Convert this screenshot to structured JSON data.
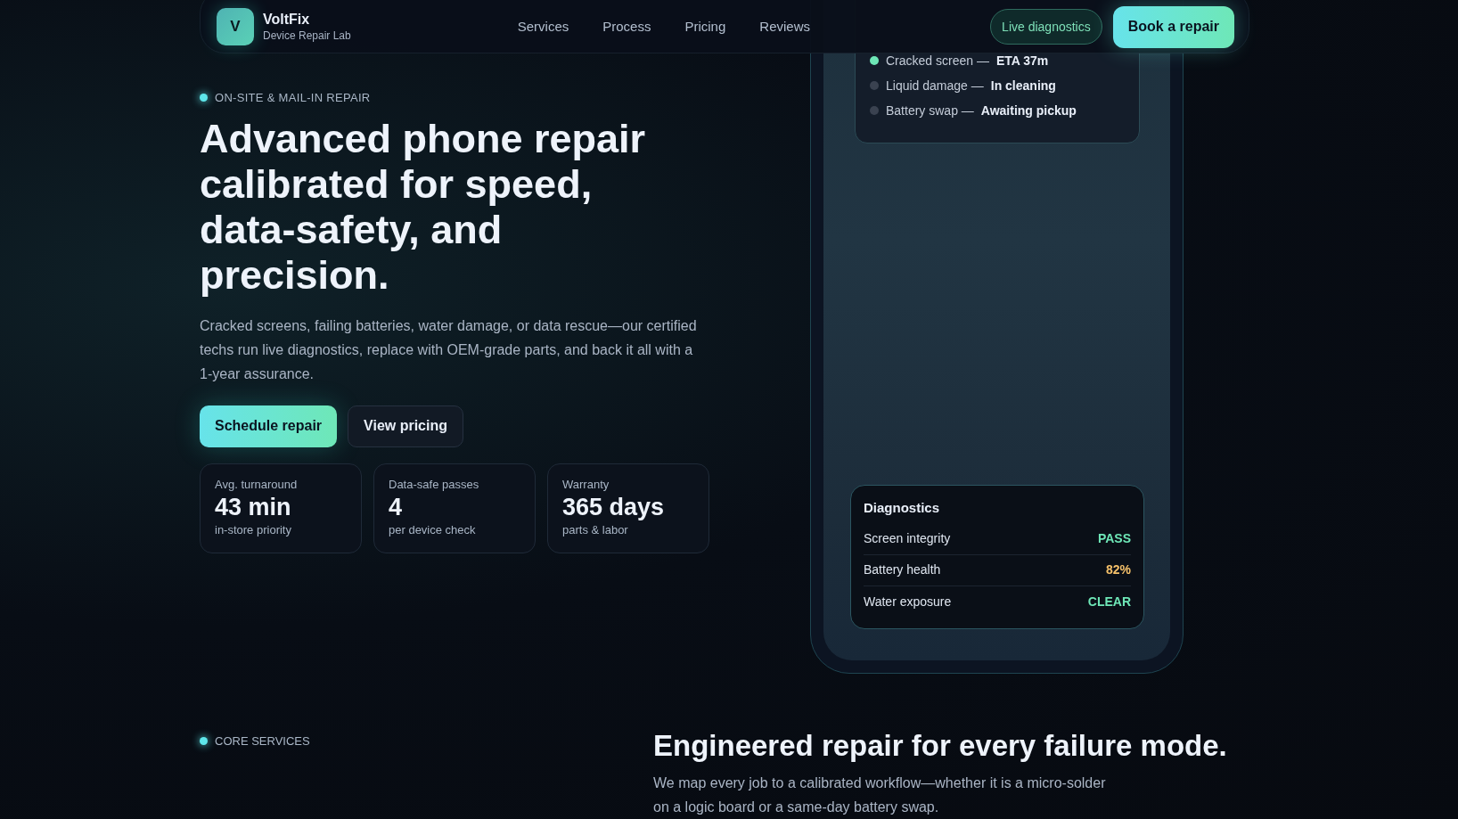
{
  "header": {
    "logo_letter": "V",
    "brand": "VoltFix",
    "tagline": "Device Repair Lab",
    "nav": [
      "Services",
      "Process",
      "Pricing",
      "Reviews"
    ],
    "live_button": "Live diagnostics",
    "cta_button": "Book a repair"
  },
  "hero": {
    "eyebrow": "ON-SITE & MAIL-IN REPAIR",
    "title": "Advanced phone repair calibrated for speed, data-safety, and precision.",
    "description": "Cracked screens, failing batteries, water damage, or data rescue—our certified techs run live diagnostics, replace with OEM-grade parts, and back it all with a 1-year assurance.",
    "primary_button": "Schedule repair",
    "secondary_button": "View pricing",
    "stats": [
      {
        "label": "Avg. turnaround",
        "value": "43 min",
        "note": "in-store priority"
      },
      {
        "label": "Data-safe passes",
        "value": "4",
        "note": "per device check"
      },
      {
        "label": "Warranty",
        "value": "365 days",
        "note": "parts & labor"
      }
    ]
  },
  "phone": {
    "queue": [
      {
        "job": "Cracked screen —",
        "status": "ETA 37m",
        "active": true
      },
      {
        "job": "Liquid damage —",
        "status": "In cleaning",
        "active": false
      },
      {
        "job": "Battery swap —",
        "status": "Awaiting pickup",
        "active": false
      }
    ],
    "diagnostics": {
      "title": "Diagnostics",
      "rows": [
        {
          "label": "Screen integrity",
          "value": "PASS",
          "kind": "ok"
        },
        {
          "label": "Battery health",
          "value": "82%",
          "kind": "warn"
        },
        {
          "label": "Water exposure",
          "value": "CLEAR",
          "kind": "ok"
        }
      ]
    }
  },
  "services": {
    "eyebrow": "CORE SERVICES",
    "title": "Engineered repair for every failure mode.",
    "description": "We map every job to a calibrated workflow—whether it is a micro-solder on a logic board or a same-day battery swap."
  }
}
